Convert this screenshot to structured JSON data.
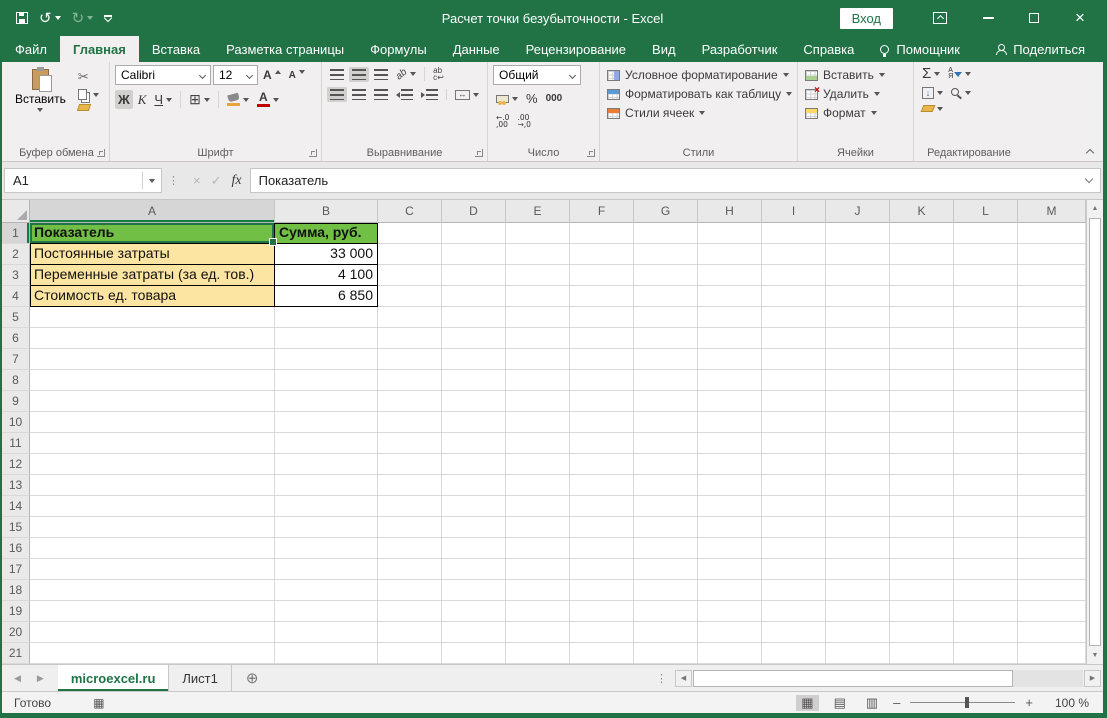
{
  "window": {
    "title": "Расчет точки безубыточности - Excel",
    "sign_in_label": "Вход"
  },
  "ribbon_tabs": [
    {
      "id": "file",
      "label": "Файл"
    },
    {
      "id": "home",
      "label": "Главная",
      "active": true
    },
    {
      "id": "insert",
      "label": "Вставка"
    },
    {
      "id": "page-layout",
      "label": "Разметка страницы"
    },
    {
      "id": "formulas",
      "label": "Формулы"
    },
    {
      "id": "data",
      "label": "Данные"
    },
    {
      "id": "review",
      "label": "Рецензирование"
    },
    {
      "id": "view",
      "label": "Вид"
    },
    {
      "id": "developer",
      "label": "Разработчик"
    },
    {
      "id": "help",
      "label": "Справка"
    },
    {
      "id": "assistant",
      "label": "Помощник",
      "icon": "lightbulb"
    }
  ],
  "share_label": "Поделиться",
  "ribbon": {
    "clipboard": {
      "group_label": "Буфер обмена",
      "paste_label": "Вставить"
    },
    "font": {
      "group_label": "Шрифт",
      "font_name": "Calibri",
      "font_size": "12",
      "bold": "Ж",
      "italic": "К",
      "underline": "Ч"
    },
    "alignment": {
      "group_label": "Выравнивание"
    },
    "number": {
      "group_label": "Число",
      "format": "Общий",
      "percent": "%",
      "thousands": "000"
    },
    "styles": {
      "group_label": "Стили",
      "items": [
        "Условное форматирование",
        "Форматировать как таблицу",
        "Стили ячеек"
      ]
    },
    "cells": {
      "group_label": "Ячейки",
      "items": [
        "Вставить",
        "Удалить",
        "Формат"
      ]
    },
    "editing": {
      "group_label": "Редактирование"
    }
  },
  "formula_bar": {
    "name_box": "A1",
    "fx_label": "fx",
    "content": "Показатель"
  },
  "grid": {
    "columns": [
      "A",
      "B",
      "C",
      "D",
      "E",
      "F",
      "G",
      "H",
      "I",
      "J",
      "K",
      "L",
      "M"
    ],
    "row_count": 21,
    "selected_cell": "A1",
    "selected_column": "A",
    "selected_row": 1,
    "table_rows": [
      {
        "a": "Показатель",
        "b": "Сумма, руб."
      },
      {
        "a": "Постоянные затраты",
        "b": "33 000"
      },
      {
        "a": "Переменные затраты (за ед. тов.)",
        "b": "4 100"
      },
      {
        "a": "Стоимость ед. товара",
        "b": "6 850"
      }
    ]
  },
  "sheet_bar": {
    "tabs": [
      {
        "label": "microexcel.ru",
        "active": true
      },
      {
        "label": "Лист1"
      }
    ]
  },
  "status_bar": {
    "mode": "Готово",
    "zoom_level": "100 %"
  },
  "icons": {
    "undo": "↺",
    "redo": "↻",
    "scissors": "✂",
    "borders_grid": "⊞",
    "merge_arrows": "↔",
    "cancel": "×",
    "enter": "✓",
    "arrow_left": "◀",
    "arrow_right": "▶",
    "arrow_up": "▲",
    "arrow_down": "▼",
    "add_sheet": "⊕",
    "view_normal": "▦",
    "view_page_layout": "▤",
    "view_page_break": "▥",
    "dots_vertical": "⋮",
    "sigma": "Σ",
    "sort_a": "А",
    "sort_z": "Я",
    "wrap_top": "ab",
    "wrap_bottom": "c↩",
    "orientation": "ab",
    "fill_down": "↓",
    "inc_dec_top": "←.0",
    "inc_dec_bottom": ",00",
    "dec_dec_top": ".00",
    "dec_dec_bottom": "→,0",
    "letter_a": "А",
    "minimize": "—",
    "close": "×",
    "macro": "▦",
    "zoom_minus": "–",
    "zoom_plus": "+"
  },
  "colors": {
    "excel_green": "#217346",
    "tab_accent": "#107C41",
    "header_fill": "#71BF44",
    "row_fill": "#FCE4A2"
  }
}
